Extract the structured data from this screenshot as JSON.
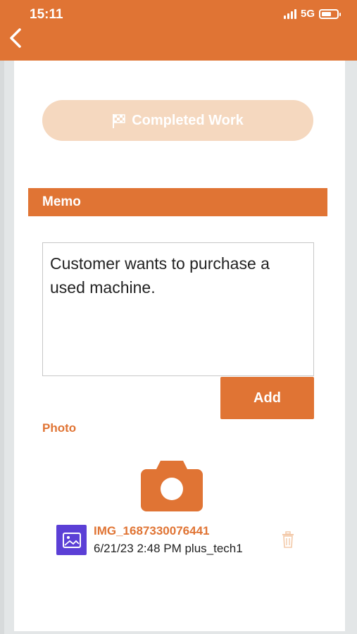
{
  "status_bar": {
    "time": "15:11",
    "network": "5G"
  },
  "header": {
    "back_icon": "chevron-left-icon"
  },
  "completed_button": {
    "label": "Completed Work",
    "icon": "checkered-flag-icon"
  },
  "memo": {
    "section_title": "Memo",
    "text": "Customer wants to purchase a used machine."
  },
  "add_button": {
    "label": "Add"
  },
  "photo": {
    "section_title": "Photo",
    "camera_icon": "camera-icon",
    "files": [
      {
        "name": "IMG_1687330076441",
        "meta": "6/21/23 2:48 PM  plus_tech1",
        "icon": "image-file-icon",
        "delete_icon": "trash-icon"
      }
    ]
  },
  "colors": {
    "accent": "#e07434",
    "accent_light": "#f5d8bf",
    "thumb": "#5b3fd6"
  }
}
